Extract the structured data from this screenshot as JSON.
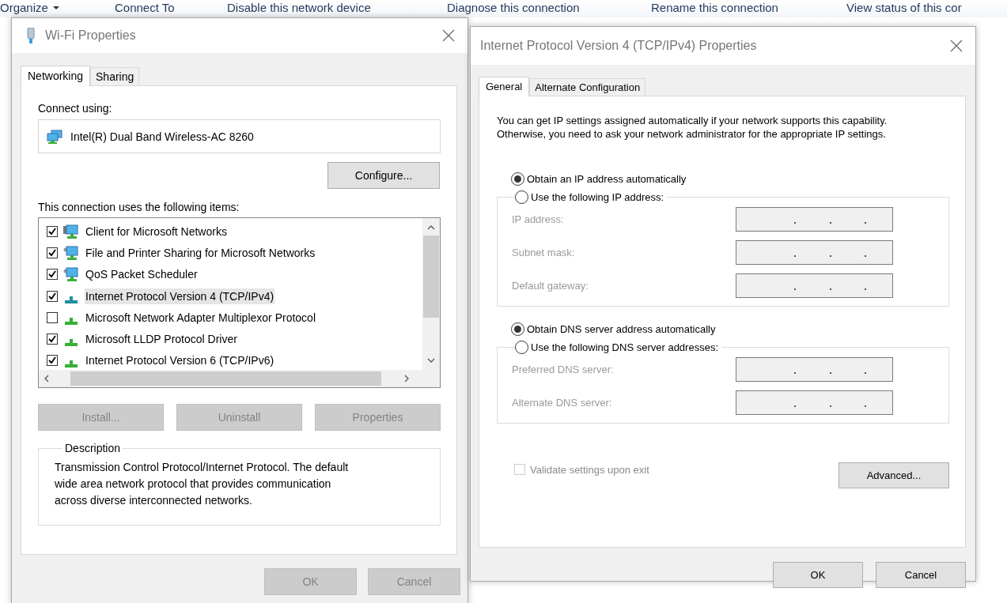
{
  "toolbar": [
    {
      "label": "Organize",
      "dropdown": true
    },
    {
      "label": "Connect To",
      "dropdown": false
    },
    {
      "label": "Disable this network device",
      "dropdown": false
    },
    {
      "label": "Diagnose this connection",
      "dropdown": false
    },
    {
      "label": "Rename this connection",
      "dropdown": false
    },
    {
      "label": "View status of this cor",
      "dropdown": false
    }
  ],
  "wifi_dialog": {
    "title": "Wi-Fi Properties",
    "tabs": [
      {
        "label": "Networking",
        "selected": true
      },
      {
        "label": "Sharing",
        "selected": false
      }
    ],
    "connect_label": "Connect using:",
    "adapter": "Intel(R) Dual Band Wireless-AC 8260",
    "configure_button": {
      "label": "Configure...",
      "disabled": false
    },
    "items_label": "This connection uses the following items:",
    "items": [
      {
        "label": "Client for Microsoft Networks",
        "checked": true,
        "selected": false,
        "kind": "client"
      },
      {
        "label": "File and Printer Sharing for Microsoft Networks",
        "checked": true,
        "selected": false,
        "kind": "service"
      },
      {
        "label": "QoS Packet Scheduler",
        "checked": true,
        "selected": false,
        "kind": "service"
      },
      {
        "label": "Internet Protocol Version 4 (TCP/IPv4)",
        "checked": true,
        "selected": true,
        "kind": "protocol"
      },
      {
        "label": "Microsoft Network Adapter Multiplexor Protocol",
        "checked": false,
        "selected": false,
        "kind": "protocol"
      },
      {
        "label": "Microsoft LLDP Protocol Driver",
        "checked": true,
        "selected": false,
        "kind": "protocol"
      },
      {
        "label": "Internet Protocol Version 6 (TCP/IPv6)",
        "checked": true,
        "selected": false,
        "kind": "protocol"
      }
    ],
    "item_buttons": [
      {
        "label": "Install...",
        "disabled": true
      },
      {
        "label": "Uninstall",
        "disabled": true
      },
      {
        "label": "Properties",
        "disabled": true
      }
    ],
    "description": {
      "title": "Description",
      "text": "Transmission Control Protocol/Internet Protocol. The default wide area network protocol that provides communication across diverse interconnected networks."
    },
    "buttons": [
      {
        "label": "OK",
        "disabled": true
      },
      {
        "label": "Cancel",
        "disabled": true
      }
    ]
  },
  "ipv4_dialog": {
    "title": "Internet Protocol Version 4 (TCP/IPv4) Properties",
    "tabs": [
      {
        "label": "General",
        "selected": true
      },
      {
        "label": "Alternate Configuration",
        "selected": false
      }
    ],
    "intro": "You can get IP settings assigned automatically if your network supports this capability. Otherwise, you need to ask your network administrator for the appropriate IP settings.",
    "ip_options": [
      {
        "label": "Obtain an IP address automatically",
        "selected": true
      },
      {
        "label": "Use the following IP address:",
        "selected": false
      }
    ],
    "ip_fields": [
      {
        "label": "IP address:",
        "disabled": true
      },
      {
        "label": "Subnet mask:",
        "disabled": true
      },
      {
        "label": "Default gateway:",
        "disabled": true
      }
    ],
    "dns_options": [
      {
        "label": "Obtain DNS server address automatically",
        "selected": true
      },
      {
        "label": "Use the following DNS server addresses:",
        "selected": false
      }
    ],
    "dns_fields": [
      {
        "label": "Preferred DNS server:",
        "disabled": true
      },
      {
        "label": "Alternate DNS server:",
        "disabled": true
      }
    ],
    "validate": {
      "label": "Validate settings upon exit",
      "checked": false,
      "disabled": true
    },
    "advanced_button": {
      "label": "Advanced...",
      "disabled": false
    },
    "buttons": [
      {
        "label": "OK",
        "disabled": false
      },
      {
        "label": "Cancel",
        "disabled": false
      }
    ]
  }
}
